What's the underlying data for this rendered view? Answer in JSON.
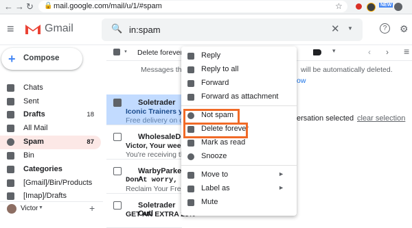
{
  "browser": {
    "url": "mail.google.com/mail/u/1/#spam",
    "badge": "NEW"
  },
  "gmail": {
    "logo_text": "Gmail",
    "search_value": "in:spam"
  },
  "compose_label": "Compose",
  "sidebar": {
    "items": [
      {
        "label": "Chats",
        "count": "",
        "icon": "chat-icon"
      },
      {
        "label": "Sent",
        "count": "",
        "icon": "send-icon"
      },
      {
        "label": "Drafts",
        "count": "18",
        "icon": "draft-icon"
      },
      {
        "label": "All Mail",
        "count": "",
        "icon": "mail-icon"
      },
      {
        "label": "Spam",
        "count": "87",
        "icon": "spam-icon"
      },
      {
        "label": "Bin",
        "count": "",
        "icon": "trash-icon"
      },
      {
        "label": "Categories",
        "count": "",
        "icon": "label-icon"
      },
      {
        "label": "[Gmail]/Bin/Products",
        "count": "",
        "icon": "label-icon"
      },
      {
        "label": "[Imap]/Drafts",
        "count": "",
        "icon": "label-icon"
      }
    ],
    "user_name": "Victor"
  },
  "toolbar": {
    "delete_forever_label": "Delete forever",
    "spam_notice_start": "Messages that",
    "spam_notice_end": "will be automatically deleted.",
    "spam_notice_link": "ow",
    "conversation_selected": "ersation selected",
    "clear_selection": "clear selection"
  },
  "emails": [
    {
      "sender": "Soletrader",
      "subject": "Iconic Trainers you",
      "snippet": "Free delivery on ord",
      "selected": true
    },
    {
      "sender": "WholesaleDeals",
      "subject": "Victor, Your weekly",
      "snippet": "You're receiving this",
      "selected": false
    },
    {
      "sender": "WarbyParker A",
      "subject": "Don't worry, we've",
      "snippet": "Reclaim Your Freede",
      "selected": false
    },
    {
      "sender": "Soletrader Outl",
      "subject": "GET AN EXTRA 25%",
      "snippet": "",
      "selected": false
    }
  ],
  "context_menu": {
    "items": [
      {
        "label": "Reply",
        "icon": "reply-icon"
      },
      {
        "label": "Reply to all",
        "icon": "reply-all-icon"
      },
      {
        "label": "Forward",
        "icon": "forward-icon"
      },
      {
        "label": "Forward as attachment",
        "icon": "attachment-icon"
      },
      {
        "label": "Not spam",
        "icon": "not-spam-icon"
      },
      {
        "label": "Delete forever",
        "icon": "trash-icon"
      },
      {
        "label": "Mark as read",
        "icon": "mark-read-icon"
      },
      {
        "label": "Snooze",
        "icon": "clock-icon"
      },
      {
        "label": "Move to",
        "icon": "move-icon"
      },
      {
        "label": "Label as",
        "icon": "label-icon"
      },
      {
        "label": "Mute",
        "icon": "mute-icon"
      }
    ]
  },
  "colors": {
    "highlight": "#f06a27",
    "spam_bg": "#fce8e6",
    "selected_row": "#c2dbff",
    "link": "#1a73e8"
  }
}
